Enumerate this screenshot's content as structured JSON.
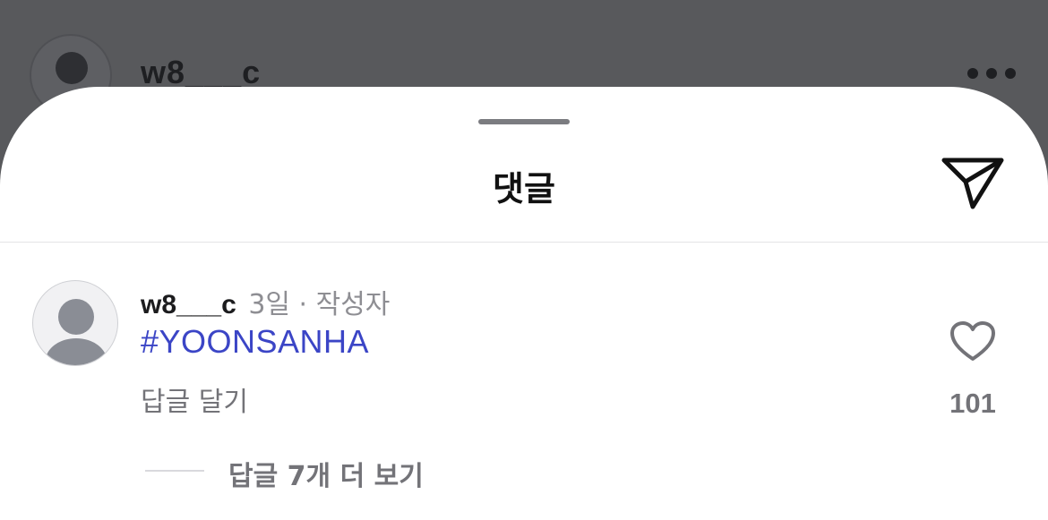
{
  "background_post": {
    "username": "w8___c"
  },
  "sheet": {
    "title": "댓글"
  },
  "comment": {
    "username": "w8___c",
    "time_author": "3일 · 작성자",
    "text": "#YOONSANHA",
    "reply_label": "답글 달기",
    "like_count": "101",
    "view_replies_label": "답글 7개 더 보기"
  },
  "icons": {
    "share": "paper-plane-icon",
    "like": "heart-icon",
    "more": "more-horizontal-icon"
  },
  "colors": {
    "hashtag": "#3b45c6",
    "overlay": "#58595c",
    "secondary_text": "#737378"
  }
}
